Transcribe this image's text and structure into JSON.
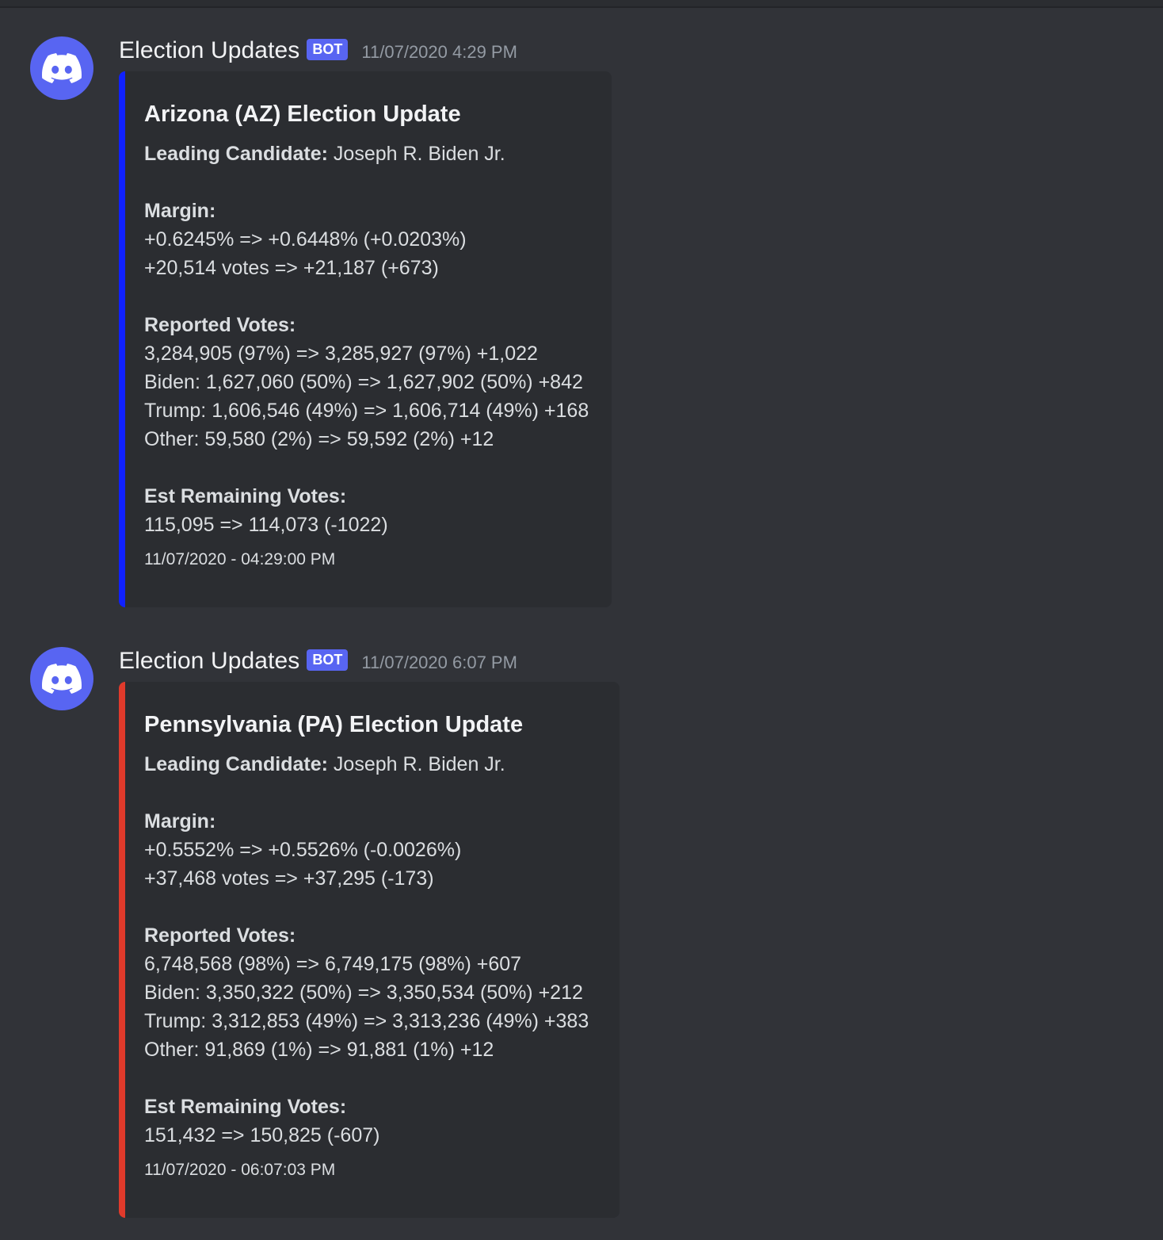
{
  "messages": [
    {
      "author": "Election Updates",
      "bot_tag": "BOT",
      "timestamp": "11/07/2020 4:29 PM",
      "avatar_icon": "discord-logo-icon",
      "embed": {
        "accent_color": "#1021ff",
        "title": "Arizona (AZ) Election Update",
        "leading_label": "Leading Candidate:",
        "leading_value": " Joseph R. Biden Jr.",
        "margin_label": "Margin:",
        "margin_lines": [
          "+0.6245% => +0.6448% (+0.0203%)",
          "+20,514 votes => +21,187 (+673)"
        ],
        "reported_label": "Reported Votes:",
        "reported_lines": [
          "3,284,905 (97%) => 3,285,927 (97%) +1,022",
          "Biden: 1,627,060 (50%) => 1,627,902 (50%) +842",
          "Trump: 1,606,546 (49%) => 1,606,714 (49%) +168",
          "Other: 59,580 (2%) => 59,592 (2%) +12"
        ],
        "remaining_label": "Est Remaining Votes:",
        "remaining_line": "115,095 => 114,073 (-1022)",
        "footer": "11/07/2020 - 04:29:00 PM"
      }
    },
    {
      "author": "Election Updates",
      "bot_tag": "BOT",
      "timestamp": "11/07/2020 6:07 PM",
      "avatar_icon": "discord-logo-icon",
      "embed": {
        "accent_color": "#e03a2b",
        "title": "Pennsylvania (PA) Election Update",
        "leading_label": "Leading Candidate:",
        "leading_value": " Joseph R. Biden Jr.",
        "margin_label": "Margin:",
        "margin_lines": [
          "+0.5552% => +0.5526% (-0.0026%)",
          "+37,468 votes => +37,295 (-173)"
        ],
        "reported_label": "Reported Votes:",
        "reported_lines": [
          "6,748,568 (98%) => 6,749,175 (98%) +607",
          "Biden: 3,350,322 (50%) => 3,350,534 (50%) +212",
          "Trump: 3,312,853 (49%) => 3,313,236 (49%) +383",
          "Other: 91,869 (1%) => 91,881 (1%) +12"
        ],
        "remaining_label": "Est Remaining Votes:",
        "remaining_line": "151,432 => 150,825 (-607)",
        "footer": "11/07/2020 - 06:07:03 PM"
      }
    }
  ]
}
